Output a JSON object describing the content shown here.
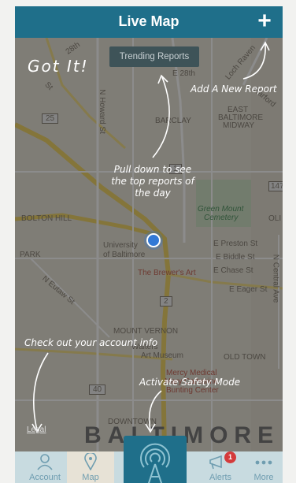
{
  "header": {
    "title": "Live Map",
    "add_icon": "plus-icon"
  },
  "map": {
    "trending_button": "Trending Reports",
    "labels": {
      "bolton_hill": "BOLTON HILL",
      "park": "PARK",
      "university": "University",
      "of_baltimore": "of Baltimore",
      "brewers_art": "The Brewer's Art",
      "green_mount": "Green Mount",
      "cemetery": "Cemetery",
      "east_baltimore": "EAST",
      "east_baltimore2": "BALTIMORE",
      "midway": "MIDWAY",
      "barclay": "BARCLAY",
      "e_preston": "E Preston St",
      "e_biddle": "E Biddle St",
      "e_chase": "E Chase St",
      "e_eager": "E Eager St",
      "n_central": "N Central Ave",
      "n_eutaw": "N Eutaw St",
      "n_howard": "N Howard St",
      "mount_vernon": "MOUNT VERNON",
      "walters": "Walters",
      "art_museum": "Art Museum",
      "old_town": "OLD TOWN",
      "mercy1": "Mercy Medical",
      "mercy2": "Mary Catherine",
      "mercy3": "Bunting Center",
      "downtown": "DOWNTOWN",
      "baltimore": "BALTIMORE",
      "route_25": "25",
      "route_1": "1",
      "route_2": "2",
      "route_40": "40",
      "route_147": "147",
      "loch_raven": "Loch Raven",
      "harford": "Harford",
      "e_28th": "E 28th",
      "w_28th": "28th",
      "n_st": "St",
      "olive": "OLI"
    },
    "legal": "Legal"
  },
  "coachmarks": {
    "got_it": "Got It!",
    "add_report": "Add A New Report",
    "pull_down": "Pull down to see the top reports of the day",
    "account_info": "Check out your account info",
    "safety_mode": "Activate Safety Mode"
  },
  "tabbar": {
    "account": "Account",
    "map": "Map",
    "alerts": "Alerts",
    "alerts_badge": "1",
    "more": "More"
  },
  "colors": {
    "header": "#1f6f8a",
    "tabbar": "#c8dbe0",
    "badge": "#d43a3a",
    "location": "#3279d6"
  }
}
